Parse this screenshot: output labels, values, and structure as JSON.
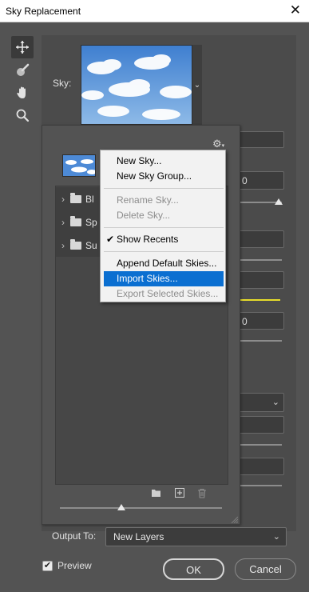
{
  "window": {
    "title": "Sky Replacement",
    "close_glyph": "✕"
  },
  "tools": [
    {
      "name": "move-sky-tool",
      "icon": "move-icon"
    },
    {
      "name": "sky-brush-tool",
      "icon": "brush-icon"
    },
    {
      "name": "hand-tool",
      "icon": "hand-icon"
    },
    {
      "name": "zoom-tool",
      "icon": "zoom-icon"
    }
  ],
  "sky": {
    "label": "Sky:",
    "dropdown_glyph": "⌄"
  },
  "preset_panel": {
    "gear_glyph": "⚙",
    "gear_caret": "▾",
    "folders": [
      {
        "label": "Bl"
      },
      {
        "label": "Sp"
      },
      {
        "label": "Su"
      }
    ],
    "size_level": 0.38
  },
  "context_menu": {
    "items": [
      {
        "label": "New Sky...",
        "state": "normal"
      },
      {
        "label": "New Sky Group...",
        "state": "normal"
      },
      {
        "label": "Rename Sky...",
        "state": "disabled"
      },
      {
        "label": "Delete Sky...",
        "state": "disabled"
      },
      {
        "label": "Show Recents",
        "state": "checked"
      },
      {
        "label": "Append Default Skies...",
        "state": "normal"
      },
      {
        "label": "Import Skies...",
        "state": "selected"
      },
      {
        "label": "Export Selected Skies...",
        "state": "disabled"
      }
    ]
  },
  "adjustments": {
    "value_1": "0",
    "value_2": "0"
  },
  "output": {
    "label": "Output To:",
    "value": "New Layers"
  },
  "preview": {
    "label": "Preview",
    "checked": true
  },
  "buttons": {
    "ok": "OK",
    "cancel": "Cancel"
  },
  "colors": {
    "menu_highlight": "#0b6fd1",
    "lighting_mode_accent": "#e6dc2b"
  }
}
